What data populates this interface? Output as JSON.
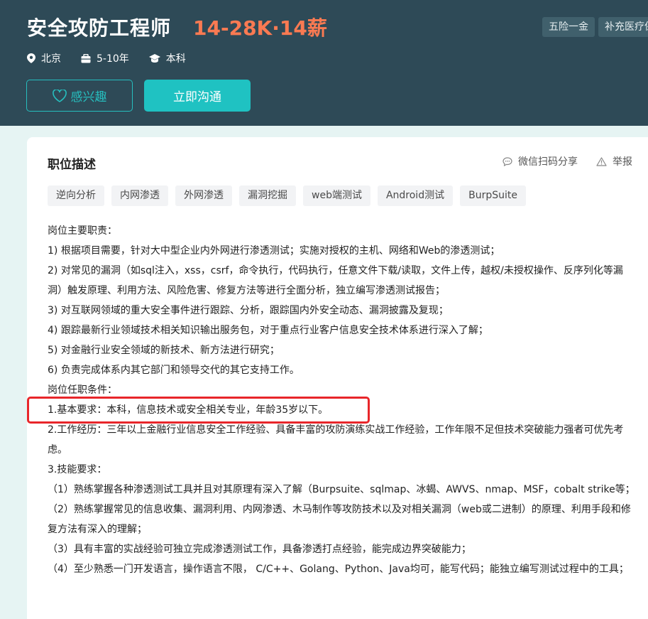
{
  "header": {
    "job_title": "安全攻防工程师",
    "salary": "14-28K·14薪",
    "benefit_tags": [
      "五险一金",
      "补充医疗保"
    ],
    "meta": {
      "city": "北京",
      "experience": "5-10年",
      "education": "本科"
    },
    "buttons": {
      "interest": "感兴趣",
      "chat": "立即沟通"
    }
  },
  "card": {
    "title": "职位描述",
    "actions": {
      "share": "微信扫码分享",
      "report": "举报"
    },
    "skill_tags": [
      "逆向分析",
      "内网渗透",
      "外网渗透",
      "漏洞挖掘",
      "web端测试",
      "Android测试",
      "BurpSuite"
    ],
    "description_lines": [
      "岗位主要职责：",
      "1) 根据项目需要，针对大中型企业内外网进行渗透测试；实施对授权的主机、网络和Web的渗透测试；",
      "2) 对常见的漏洞（如sql注入，xss，csrf，命令执行，代码执行，任意文件下载/读取，文件上传，越权/未授权操作、反序列化等漏洞）触发原理、利用方法、风险危害、修复方法等进行全面分析，独立编写渗透测试报告；",
      "3) 对互联网领域的重大安全事件进行跟踪、分析，跟踪国内外安全动态、漏洞披露及复现；",
      "4) 跟踪最新行业领域技术相关知识输出服务包，对于重点行业客户信息安全技术体系进行深入了解；",
      "5) 对金融行业安全领域的新技术、新方法进行研究；",
      "6) 负责完成体系内其它部门和领导交代的其它支持工作。",
      "岗位任职条件：",
      "1.基本要求：本科，信息技术或安全相关专业，年龄35岁以下。",
      "2.工作经历：三年以上金融行业信息安全工作经验、具备丰富的攻防演练实战工作经验，工作年限不足但技术突破能力强者可优先考虑。",
      "3.技能要求：",
      "（1）熟练掌握各种渗透测试工具并且对其原理有深入了解（Burpsuite、sqlmap、冰蝎、AWVS、nmap、MSF，cobalt strike等；",
      "（2）熟练掌握常见的信息收集、漏洞利用、内网渗透、木马制作等攻防技术以及对相关漏洞（web或二进制）的原理、利用手段和修复方法有深入的理解；",
      "（3）具有丰富的实战经验可独立完成渗透测试工作，具备渗透打点经验，能完成边界突破能力；",
      "（4）至少熟悉一门开发语言，操作语言不限， C/C++、Golang、Python、Java均可，能写代码；能独立编写测试过程中的工具；"
    ]
  },
  "colors": {
    "header_bg": "#2e4a57",
    "salary": "#fa7a52",
    "accent": "#1fc2c2",
    "highlight": "#e8262a"
  },
  "icons": {
    "city": "location-pin-icon",
    "experience": "briefcase-icon",
    "education": "graduation-cap-icon",
    "interest": "heart-icon",
    "share": "chat-bubble-icon",
    "report": "warning-triangle-icon"
  }
}
